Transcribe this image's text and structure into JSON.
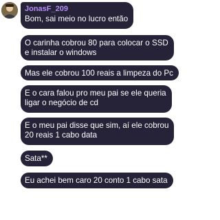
{
  "sender": {
    "name": "JonasF_209",
    "avatar_icon": "user-avatar-icon"
  },
  "messages": [
    {
      "lines": [
        "Bom, sai meio no lucro então"
      ]
    },
    {
      "lines": [
        "O carinha cobrou 80 para colocar o SSD",
        "e instalar o windows"
      ]
    },
    {
      "lines": [
        "Mas ele cobrou 100 reais a limpeza do Pc"
      ]
    },
    {
      "lines": [
        "E o cara falou pro meu pai se ele queria",
        "ligar o negócio de cd"
      ]
    },
    {
      "lines": [
        "E o meu pai disse que sim, aí ele cobrou",
        "20 reais 1 cabo data"
      ]
    },
    {
      "lines": [
        "Sata**"
      ]
    },
    {
      "lines": [
        "Eu achei bem caro 20 conto 1 cabo sata"
      ]
    }
  ],
  "colors": {
    "bubble_bg": "#262338",
    "bubble_text": "#ffffff",
    "author_name": "#b48ef5",
    "page_bg": "#ffffff"
  }
}
